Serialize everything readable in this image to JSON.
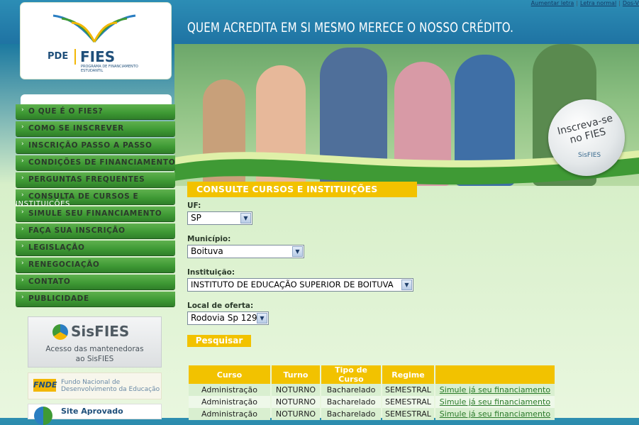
{
  "top_links": [
    "Aumentar letra",
    "Letra normal",
    "Dos-V"
  ],
  "slogan": "QUEM ACREDITA EM SI MESMO MERECE O NOSSO CRÉDITO.",
  "logo": {
    "pde": "PDE",
    "fies": "FIES",
    "subtitle_1": "PROGRAMA DE FINANCIAMENTO",
    "subtitle_2": "ESTUDANTIL"
  },
  "badge": {
    "line1": "Inscreva-se",
    "line2": "no FIES",
    "brand": "SisFIES"
  },
  "menu": [
    "O QUE É O FIES?",
    "COMO SE INSCREVER",
    "INSCRIÇÃO PASSO A PASSO",
    "CONDIÇÕES DE FINANCIAMENTO",
    "PERGUNTAS FREQUENTES",
    "CONSULTA DE CURSOS E",
    "SIMULE SEU FINANCIAMENTO",
    "FAÇA SUA INSCRIÇÃO",
    "LEGISLAÇÃO",
    "RENEGOCIAÇÃO",
    "CONTATO",
    "PUBLICIDADE"
  ],
  "menu_overflow": "INSTITUIÇÕES",
  "sisfies_promo": {
    "brand": "SisFIES",
    "line1": "Acesso das mantenedoras",
    "line2": "ao SisFIES"
  },
  "fnde": {
    "logo": "FNDE",
    "line1": "Fundo Nacional de",
    "line2": "Desenvolvimento da Educação"
  },
  "site_aprovado": "Site Aprovado",
  "section_title": "CONSULTE CURSOS E INSTITUIÇÕES",
  "form": {
    "uf_label": "UF:",
    "uf_value": "SP",
    "municipio_label": "Município:",
    "municipio_value": "Boituva",
    "instituicao_label": "Instituição:",
    "instituicao_value": "INSTITUTO DE EDUCAÇÃO SUPERIOR DE BOITUVA",
    "local_label": "Local de oferta:",
    "local_value": "Rodovia Sp 129",
    "search_button": "Pesquisar"
  },
  "results": {
    "headers": [
      "Curso",
      "Turno",
      "Tipo de Curso",
      "Regime",
      ""
    ],
    "rows": [
      [
        "Administração",
        "NOTURNO",
        "Bacharelado",
        "SEMESTRAL",
        "Simule já seu financiamento"
      ],
      [
        "Administração",
        "NOTURNO",
        "Bacharelado",
        "SEMESTRAL",
        "Simule já seu financiamento"
      ],
      [
        "Administração",
        "NOTURNO",
        "Bacharelado",
        "SEMESTRAL",
        "Simule já seu financiamento"
      ]
    ]
  },
  "colors": {
    "accent_yellow": "#f2c200",
    "menu_green": "#3f9a35",
    "brand_blue": "#1f4f7a"
  }
}
